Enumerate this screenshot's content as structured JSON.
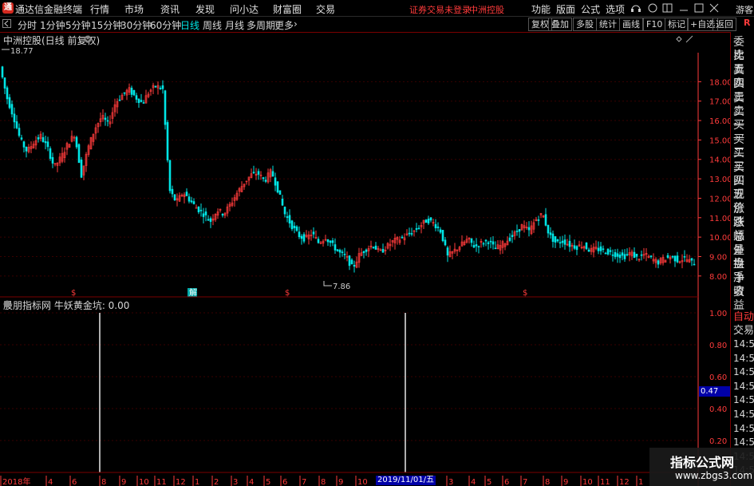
{
  "app": {
    "logo_glyph": "通",
    "title": "通达信金融终端",
    "user": "游客",
    "login_status": "证券交易未登录",
    "stock_name": "中洲控股"
  },
  "menu": [
    "行情",
    "市场",
    "资讯",
    "发现",
    "问小达",
    "财富圈",
    "交易"
  ],
  "top_right_menu": [
    "功能",
    "版面",
    "公式",
    "选项"
  ],
  "periods": [
    "分时",
    "1分钟",
    "5分钟",
    "15分钟",
    "30分钟",
    "60分钟",
    "日线",
    "周线",
    "月线",
    "多周期",
    "更多"
  ],
  "active_period": "日线",
  "toolbar_right": [
    "复权",
    "叠加",
    "多股",
    "统计",
    "画线",
    "F10",
    "标记",
    "+自选",
    "返回"
  ],
  "r_corner": "R",
  "chart": {
    "label": "中洲控股(日线 前复权)",
    "high_label": "18.77",
    "low_label": "7.86",
    "price_ticks": [
      "18.00",
      "17.00",
      "16.00",
      "15.00",
      "14.00",
      "13.00",
      "12.00",
      "11.00",
      "10.00",
      "9.00",
      "8.00"
    ],
    "markers": [
      "$",
      "解",
      "$",
      "$"
    ],
    "dates": [
      "2018年",
      "4",
      "6",
      "8",
      "9",
      "10",
      "11",
      "12",
      "1",
      "2",
      "3",
      "4",
      "5",
      "6",
      "7",
      "8",
      "9",
      "10",
      "2019/11/01/五",
      "3",
      "4",
      "5",
      "6",
      "7",
      "8",
      "9",
      "10",
      "11",
      "12",
      "1"
    ]
  },
  "indicator": {
    "label": "股朋指标网 牛妖黄金坑: 0.00",
    "ticks": [
      "1.00",
      "0.80",
      "0.60",
      "0.40",
      "0.20"
    ],
    "value_marker": "0.47"
  },
  "right_panel": {
    "labels": [
      "委比",
      "卖五",
      "卖四",
      "卖三",
      "卖二",
      "卖一",
      "买一",
      "买二",
      "买三",
      "买四",
      "买五",
      "现价",
      "涨跌",
      "涨幅",
      "总量",
      "外盘",
      "换手",
      "净资",
      "收益"
    ],
    "auto": "自动",
    "trade": "交易",
    "times": [
      "14:56",
      "14:56",
      "14:56",
      "14:56",
      "14:56",
      "14:56",
      "14:56",
      "14:56",
      "14:56",
      "14:56"
    ]
  },
  "watermark": {
    "line1": "指标公式网",
    "line2": "www.zbgs3.com"
  },
  "colors": {
    "up": "#ff3b3b",
    "down": "#00e5e5",
    "grid": "#7a0000",
    "axis": "#ff3b3b"
  },
  "chart_data": {
    "type": "line",
    "title": "中洲控股(日线 前复权)",
    "ylim": [
      7.5,
      19.0
    ],
    "series": [
      {
        "values": [
          18.77,
          17.2,
          16.2,
          15.0,
          14.4,
          14.9,
          15.2,
          14.6,
          13.6,
          14.1,
          14.8,
          15.3,
          13.2,
          14.6,
          15.6,
          16.2,
          15.8,
          16.9,
          17.3,
          17.6,
          17.2,
          16.9,
          17.5,
          17.8,
          17.6,
          12.4,
          11.8,
          12.3,
          11.9,
          11.5,
          11.2,
          10.8,
          11.4,
          11.2,
          11.7,
          12.3,
          12.8,
          13.2,
          13.3,
          12.9,
          13.4,
          12.4,
          11.2,
          10.6,
          10.1,
          9.9,
          10.2,
          9.7,
          10.0,
          9.6,
          9.2,
          9.0,
          8.4,
          9.1,
          9.4,
          9.6,
          9.2,
          9.5,
          9.8,
          9.9,
          10.1,
          10.3,
          10.6,
          10.9,
          10.7,
          10.3,
          9.0,
          9.3,
          9.6,
          9.9,
          9.5,
          9.7,
          9.8,
          9.4,
          9.6,
          9.9,
          10.2,
          10.6,
          10.3,
          10.9,
          11.2,
          10.1,
          9.7,
          9.8,
          9.6,
          9.5,
          9.6,
          9.3,
          9.4,
          9.3,
          9.2,
          9.1,
          9.0,
          9.2,
          8.9,
          9.1,
          8.9,
          8.7,
          8.9,
          9.0,
          8.8,
          8.9,
          8.7
        ]
      }
    ],
    "indicator_signals": [
      {
        "x": 125,
        "value": 1.0
      },
      {
        "x": 508,
        "value": 1.0
      }
    ]
  }
}
